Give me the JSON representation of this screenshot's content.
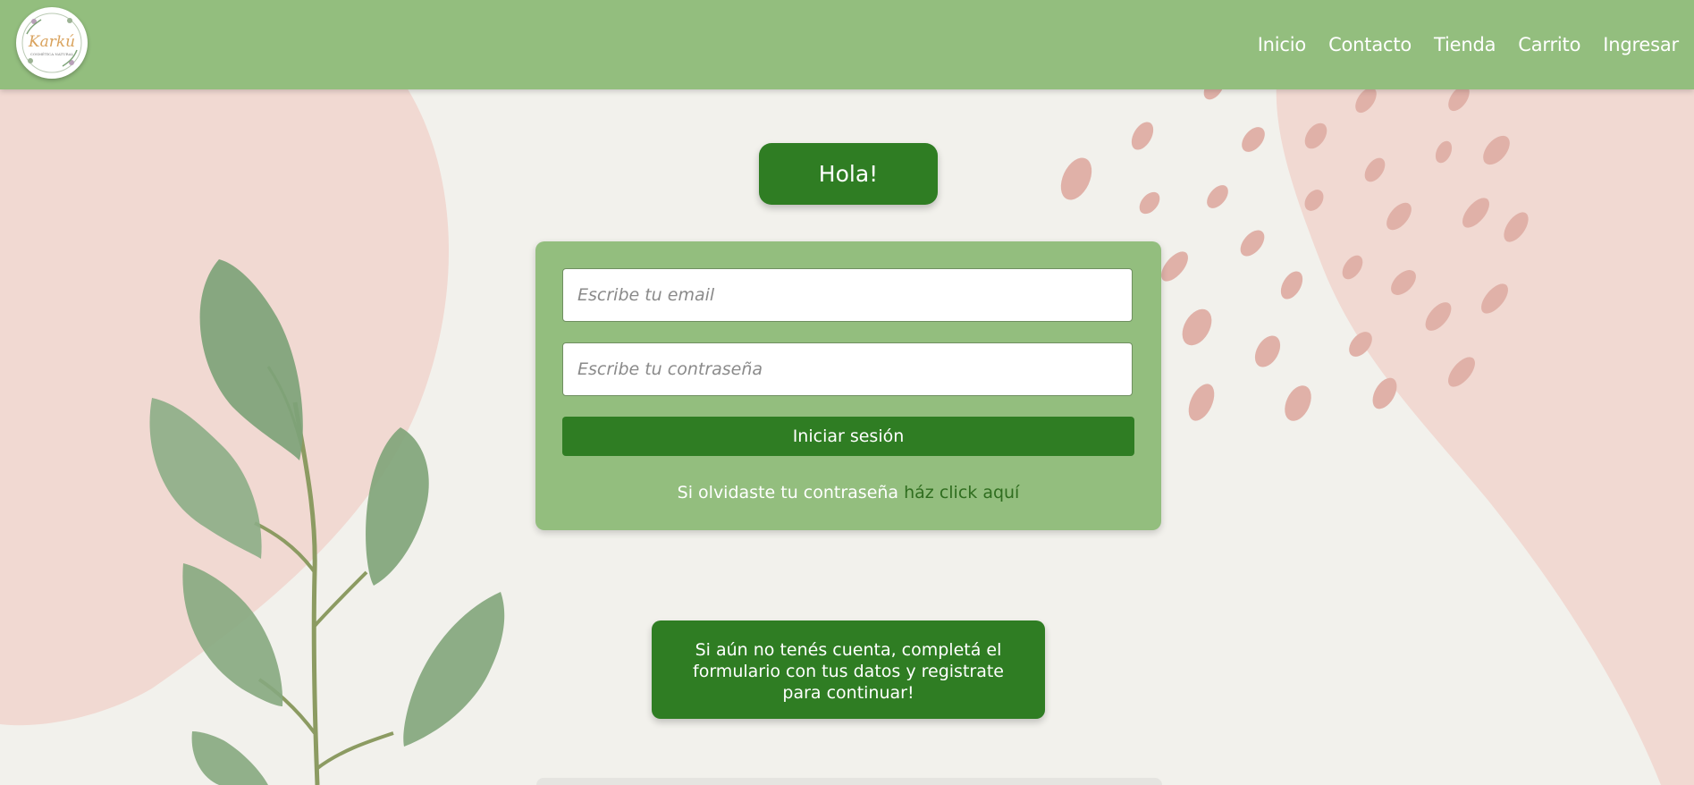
{
  "navbar": {
    "logo": {
      "brand_text": "Karkú",
      "tagline": "COSMÉTICA NATURAL"
    },
    "links": [
      {
        "label": "Inicio"
      },
      {
        "label": "Contacto"
      },
      {
        "label": "Tienda"
      },
      {
        "label": "Carrito"
      },
      {
        "label": "Ingresar"
      }
    ]
  },
  "greeting": {
    "text": "Hola!"
  },
  "login_form": {
    "email_placeholder": "Escribe tu email",
    "email_value": "",
    "password_placeholder": "Escribe tu contraseña",
    "password_value": "",
    "submit_label": "Iniciar sesión",
    "forgot_text": "Si olvidaste tu contraseña",
    "forgot_link": "ház click aquí"
  },
  "register": {
    "text": "Si aún no tenés cuenta, completá el formulario con tus datos y registrate para continuar!"
  },
  "colors": {
    "navbar": "#93be7e",
    "primary_green": "#2f7d23",
    "background": "#f2f1ec",
    "pink_shape": "#f1d9d2",
    "dots": "#e0b1a8"
  }
}
